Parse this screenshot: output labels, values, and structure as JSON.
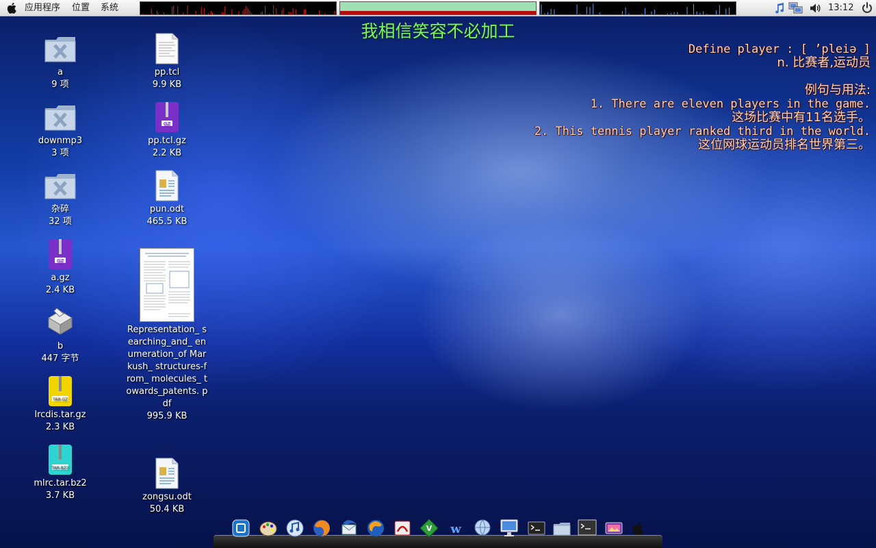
{
  "top_panel": {
    "menu": [
      "应用程序",
      "位置",
      "系统"
    ],
    "clock": "13:12",
    "tray_icons": [
      "music-note-icon",
      "network-icon",
      "volume-icon",
      "power-icon"
    ]
  },
  "overlay": {
    "lyric": "我相信笑容不必加工",
    "dict": {
      "define": "Define player : [ ’pleiə ]",
      "meaning": "n. 比赛者,运动员",
      "usage_title": "例句与用法:",
      "example1_en": "1. There are eleven players in the game.",
      "example1_cn": "这场比赛中有11名选手。",
      "example2_en": "2. This tennis player ranked third in the world.",
      "example2_cn": "这位网球运动员排名世界第三。"
    }
  },
  "desktop_icons": [
    {
      "name": "a",
      "detail": "9 项",
      "kind": "folder"
    },
    {
      "name": "downmp3",
      "detail": "3 项",
      "kind": "folder"
    },
    {
      "name": "杂碎",
      "detail": "32 项",
      "kind": "folder"
    },
    {
      "name": "a.gz",
      "detail": "2.4 KB",
      "kind": "gz"
    },
    {
      "name": "b",
      "detail": "447 字节",
      "kind": "installer"
    },
    {
      "name": "lrcdis.tar.gz",
      "detail": "2.3 KB",
      "kind": "targz"
    },
    {
      "name": "mlrc.tar.bz2",
      "detail": "3.7 KB",
      "kind": "tarbz2"
    },
    {
      "name": "pp.tcl",
      "detail": "9.9 KB",
      "kind": "text"
    },
    {
      "name": "pp.tcl.gz",
      "detail": "2.2 KB",
      "kind": "gz"
    },
    {
      "name": "pun.odt",
      "detail": "465.5 KB",
      "kind": "odt"
    },
    {
      "name": "Representation_ searching_and_ enumeration_of Markush_ structures-from_ molecules_ towards_patents. pdf",
      "detail": "995.9 KB",
      "kind": "pdf"
    },
    {
      "name": "zongsu.odt",
      "detail": "50.4 KB",
      "kind": "odt"
    }
  ],
  "dock_items": [
    "virtualbox-icon",
    "paint-palette-icon",
    "music-player-icon",
    "firefox-icon",
    "thunderbird-icon",
    "browser-icon",
    "pdf-reader-icon",
    "vim-icon",
    "wiki-icon",
    "globe-icon",
    "monitor-icon",
    "terminal-icon",
    "folder-icon",
    "terminal-window-icon",
    "image-viewer-icon",
    "apple-icon"
  ],
  "colors": {
    "lyric": "#7cf55d",
    "dict_text": "#ffd2b3",
    "mem_bar": "#9fe0b4",
    "mem_used": "#b40d0d"
  }
}
